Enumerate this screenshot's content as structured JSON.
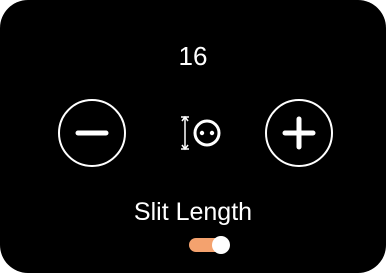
{
  "control": {
    "value": "16",
    "label": "Slit Length",
    "icon": "slit-length-icon",
    "decrement_icon": "minus-icon",
    "increment_icon": "plus-icon",
    "toggle_on": true
  },
  "colors": {
    "background": "#000000",
    "foreground": "#ffffff",
    "toggle_accent": "#f4a26e"
  }
}
